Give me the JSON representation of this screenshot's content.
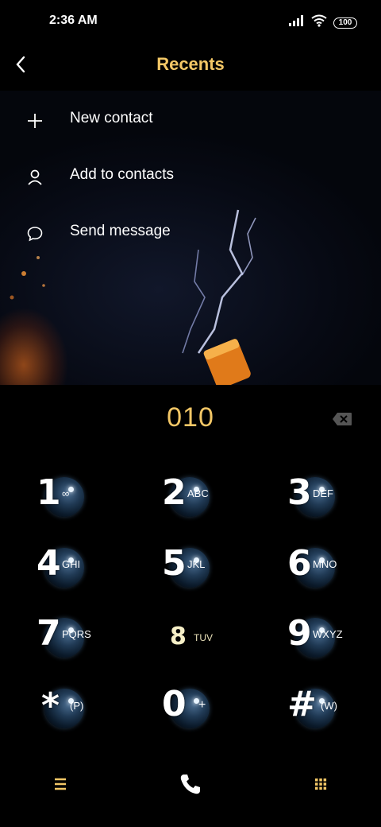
{
  "status_bar": {
    "time": "2:36 AM",
    "battery": "100"
  },
  "header": {
    "title": "Recents"
  },
  "menu": [
    {
      "label": "New contact",
      "icon": "plus-icon"
    },
    {
      "label": "Add to contacts",
      "icon": "person-icon"
    },
    {
      "label": "Send message",
      "icon": "message-bubble-icon"
    }
  ],
  "dialer": {
    "number": "010"
  },
  "keypad": [
    {
      "digit": "1",
      "letters": "∞"
    },
    {
      "digit": "2",
      "letters": "ABC"
    },
    {
      "digit": "3",
      "letters": "DEF"
    },
    {
      "digit": "4",
      "letters": "GHI"
    },
    {
      "digit": "5",
      "letters": "JKL"
    },
    {
      "digit": "6",
      "letters": "MNO"
    },
    {
      "digit": "7",
      "letters": "PQRS"
    },
    {
      "digit": "8",
      "letters": "TUV"
    },
    {
      "digit": "9",
      "letters": "WXYZ"
    },
    {
      "digit": "*",
      "letters": "(P)"
    },
    {
      "digit": "0",
      "letters": "+"
    },
    {
      "digit": "#",
      "letters": "(W)"
    }
  ],
  "bottom_bar": {
    "left_icon": "menu-icon",
    "center_icon": "phone-icon",
    "right_icon": "keypad-icon"
  },
  "colors": {
    "accent": "#f3c766",
    "background": "#000000"
  }
}
